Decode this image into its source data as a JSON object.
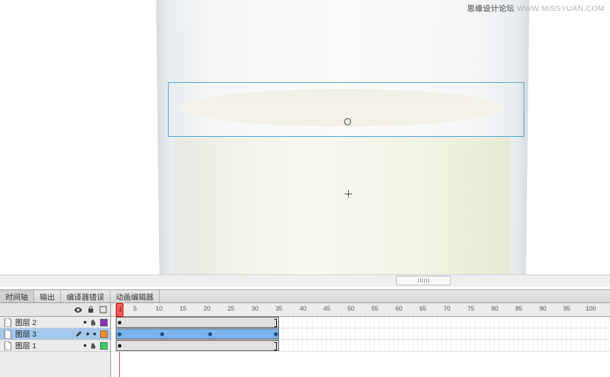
{
  "watermark": {
    "brand": "思缘设计论坛",
    "url": "WWW.MISSYUAN.COM"
  },
  "tabs": [
    "时间轴",
    "输出",
    "编译器错误",
    "动画编辑器"
  ],
  "active_tab": 0,
  "ruler_labels": [
    5,
    10,
    15,
    20,
    25,
    30,
    35,
    40,
    45,
    50,
    55,
    60,
    65,
    70,
    75,
    80,
    85,
    90,
    95,
    100
  ],
  "playhead": "1",
  "layers": [
    {
      "name": "图层 2",
      "selected": false,
      "locked": true,
      "color": "#8a2fb8",
      "span": {
        "type": "gray",
        "start": 1,
        "end": 35
      }
    },
    {
      "name": "图层 3",
      "selected": true,
      "locked": false,
      "color": "#ff8c1a",
      "span": {
        "type": "blue",
        "start": 1,
        "end": 35,
        "tweens": [
          1,
          10,
          20,
          35
        ]
      }
    },
    {
      "name": "图层 1",
      "selected": false,
      "locked": true,
      "color": "#2fd65a",
      "span": {
        "type": "gray",
        "start": 1,
        "end": 35
      }
    }
  ],
  "icons": {
    "eye": "eye-icon",
    "lock": "lock-icon",
    "outline": "outline-icon",
    "pencil": "pencil-icon",
    "page": "page-icon"
  }
}
